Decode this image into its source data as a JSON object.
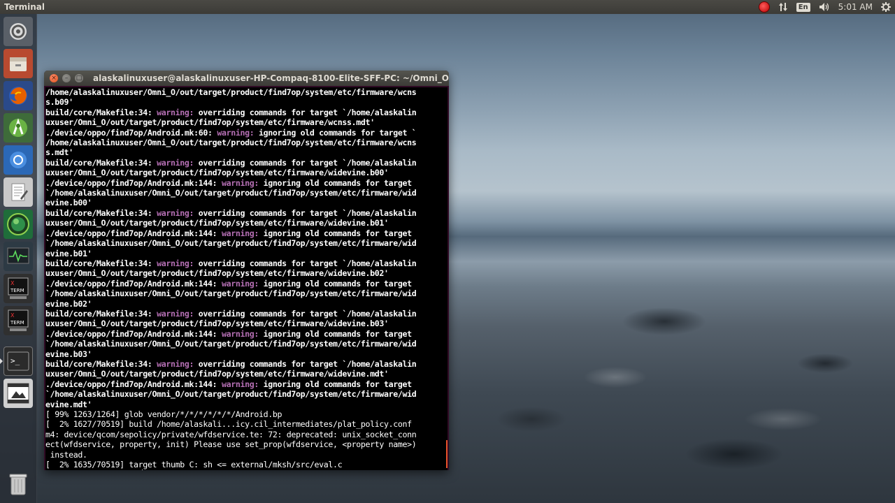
{
  "panel": {
    "title": "Terminal",
    "keyboard": "En",
    "clock": "5:01 AM",
    "icons": [
      "record-icon",
      "network-updown-icon",
      "keyboard-layout-icon",
      "volume-icon",
      "settings-gear-icon"
    ]
  },
  "launcher": {
    "items": [
      "system-settings-icon",
      "file-manager-icon",
      "firefox-icon",
      "android-studio-icon",
      "chromium-icon",
      "text-editor-icon",
      "globe-app-icon",
      "system-monitor-icon",
      "xterm-icon",
      "xterm-icon-2",
      "terminal-icon",
      "image-viewer-icon",
      "trash-icon"
    ]
  },
  "terminal": {
    "title": "alaskalinuxuser@alaskalinuxuser-HP-Compaq-8100-Elite-SFF-PC: ~/Omni_O",
    "lines": [
      [
        {
          "t": "/home/alaskalinuxuser/Omni_O/out/target/product/find7op/system/etc/firmware/wcns"
        }
      ],
      [
        {
          "t": "s.b09'"
        }
      ],
      [
        {
          "t": "build/core/Makefile:34: "
        },
        {
          "t": "warning:",
          "c": "warn"
        },
        {
          "t": " overriding commands for target `/home/alaskalin"
        }
      ],
      [
        {
          "t": "uxuser/Omni_O/out/target/product/find7op/system/etc/firmware/wcnss.mdt'"
        }
      ],
      [
        {
          "t": "./device/oppo/find7op/Android.mk:60: "
        },
        {
          "t": "warning:",
          "c": "warn"
        },
        {
          "t": " ignoring old commands for target `"
        }
      ],
      [
        {
          "t": "/home/alaskalinuxuser/Omni_O/out/target/product/find7op/system/etc/firmware/wcns"
        }
      ],
      [
        {
          "t": "s.mdt'"
        }
      ],
      [
        {
          "t": "build/core/Makefile:34: "
        },
        {
          "t": "warning:",
          "c": "warn"
        },
        {
          "t": " overriding commands for target `/home/alaskalin"
        }
      ],
      [
        {
          "t": "uxuser/Omni_O/out/target/product/find7op/system/etc/firmware/widevine.b00'"
        }
      ],
      [
        {
          "t": "./device/oppo/find7op/Android.mk:144: "
        },
        {
          "t": "warning:",
          "c": "warn"
        },
        {
          "t": " ignoring old commands for target"
        }
      ],
      [
        {
          "t": "`/home/alaskalinuxuser/Omni_O/out/target/product/find7op/system/etc/firmware/wid"
        }
      ],
      [
        {
          "t": "evine.b00'"
        }
      ],
      [
        {
          "t": "build/core/Makefile:34: "
        },
        {
          "t": "warning:",
          "c": "warn"
        },
        {
          "t": " overriding commands for target `/home/alaskalin"
        }
      ],
      [
        {
          "t": "uxuser/Omni_O/out/target/product/find7op/system/etc/firmware/widevine.b01'"
        }
      ],
      [
        {
          "t": "./device/oppo/find7op/Android.mk:144: "
        },
        {
          "t": "warning:",
          "c": "warn"
        },
        {
          "t": " ignoring old commands for target"
        }
      ],
      [
        {
          "t": "`/home/alaskalinuxuser/Omni_O/out/target/product/find7op/system/etc/firmware/wid"
        }
      ],
      [
        {
          "t": "evine.b01'"
        }
      ],
      [
        {
          "t": "build/core/Makefile:34: "
        },
        {
          "t": "warning:",
          "c": "warn"
        },
        {
          "t": " overriding commands for target `/home/alaskalin"
        }
      ],
      [
        {
          "t": "uxuser/Omni_O/out/target/product/find7op/system/etc/firmware/widevine.b02'"
        }
      ],
      [
        {
          "t": "./device/oppo/find7op/Android.mk:144: "
        },
        {
          "t": "warning:",
          "c": "warn"
        },
        {
          "t": " ignoring old commands for target"
        }
      ],
      [
        {
          "t": "`/home/alaskalinuxuser/Omni_O/out/target/product/find7op/system/etc/firmware/wid"
        }
      ],
      [
        {
          "t": "evine.b02'"
        }
      ],
      [
        {
          "t": "build/core/Makefile:34: "
        },
        {
          "t": "warning:",
          "c": "warn"
        },
        {
          "t": " overriding commands for target `/home/alaskalin"
        }
      ],
      [
        {
          "t": "uxuser/Omni_O/out/target/product/find7op/system/etc/firmware/widevine.b03'"
        }
      ],
      [
        {
          "t": "./device/oppo/find7op/Android.mk:144: "
        },
        {
          "t": "warning:",
          "c": "warn"
        },
        {
          "t": " ignoring old commands for target"
        }
      ],
      [
        {
          "t": "`/home/alaskalinuxuser/Omni_O/out/target/product/find7op/system/etc/firmware/wid"
        }
      ],
      [
        {
          "t": "evine.b03'"
        }
      ],
      [
        {
          "t": "build/core/Makefile:34: "
        },
        {
          "t": "warning:",
          "c": "warn"
        },
        {
          "t": " overriding commands for target `/home/alaskalin"
        }
      ],
      [
        {
          "t": "uxuser/Omni_O/out/target/product/find7op/system/etc/firmware/widevine.mdt'"
        }
      ],
      [
        {
          "t": "./device/oppo/find7op/Android.mk:144: "
        },
        {
          "t": "warning:",
          "c": "warn"
        },
        {
          "t": " ignoring old commands for target"
        }
      ],
      [
        {
          "t": "`/home/alaskalinuxuser/Omni_O/out/target/product/find7op/system/etc/firmware/wid"
        }
      ],
      [
        {
          "t": "evine.mdt'"
        }
      ],
      [
        {
          "t": "[ 99% 1263/1264] glob vendor/*/*/*/*/*/*/Android.bp",
          "c": "plain"
        }
      ],
      [
        {
          "t": "[  2% 1627/70519] build /home/alaskali...icy.cil_intermediates/plat_policy.conf",
          "c": "plain"
        }
      ],
      [
        {
          "t": "m4: device/qcom/sepolicy/private/wfdservice.te: 72: deprecated: unix_socket_conn",
          "c": "plain"
        }
      ],
      [
        {
          "t": "ect(wfdservice, property, init) Please use set_prop(wfdservice, <property name>)",
          "c": "plain"
        }
      ],
      [
        {
          "t": " instead.",
          "c": "plain"
        }
      ],
      [
        {
          "t": "[  2% 1635/70519] target thumb C: sh <= external/mksh/src/eval.c",
          "c": "plain"
        }
      ]
    ]
  }
}
